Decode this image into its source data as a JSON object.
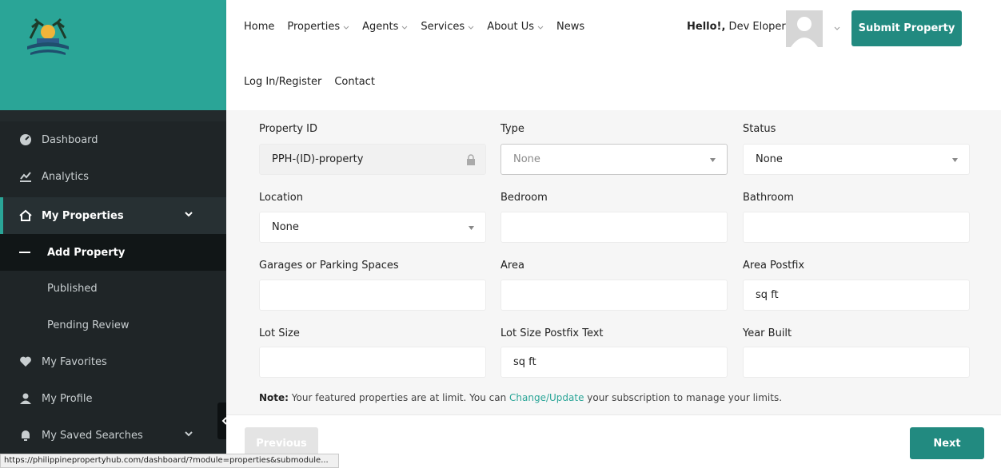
{
  "header": {
    "nav": [
      "Home",
      "Properties",
      "Agents",
      "Services",
      "About Us",
      "News"
    ],
    "nav_dropdown": [
      false,
      true,
      true,
      true,
      true,
      false
    ],
    "nav2": [
      "Log In/Register",
      "Contact"
    ],
    "hello_bold": "Hello!,",
    "hello_name": " Dev Eloper",
    "submit_label": "Submit Property"
  },
  "sidebar": {
    "dashboard": "Dashboard",
    "analytics": "Analytics",
    "my_properties": "My Properties",
    "add_property": "Add Property",
    "published": "Published",
    "pending_review": "Pending Review",
    "my_favorites": "My Favorites",
    "my_profile": "My Profile",
    "my_saved_searches": "My Saved Searches"
  },
  "form": {
    "property_id_label": "Property ID",
    "property_id_value": "PPH-(ID)-property",
    "type_label": "Type",
    "type_value": "None",
    "status_label": "Status",
    "status_value": "None",
    "location_label": "Location",
    "location_value": "None",
    "bedroom_label": "Bedroom",
    "bathroom_label": "Bathroom",
    "garages_label": "Garages or Parking Spaces",
    "area_label": "Area",
    "area_postfix_label": "Area Postfix",
    "area_postfix_value": "sq ft",
    "lot_size_label": "Lot Size",
    "lot_size_postfix_label": "Lot Size Postfix Text",
    "lot_size_postfix_value": "sq ft",
    "year_built_label": "Year Built"
  },
  "note": {
    "prefix": "Note:",
    "text1": " Your featured properties are at limit. You can ",
    "link": "Change/Update",
    "text2": " your subscription to manage your limits."
  },
  "buttons": {
    "previous": "Previous",
    "next": "Next"
  },
  "status_url": "https://philippinepropertyhub.com/dashboard/?module=properties&submodule...",
  "colors": {
    "brand": "#2aa597",
    "button": "#228a80",
    "sidebar": "#1f2527"
  }
}
